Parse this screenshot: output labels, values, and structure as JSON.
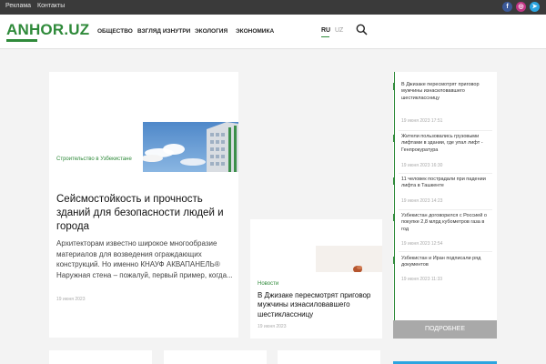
{
  "topbar": {
    "links": [
      "Реклама",
      "Контакты"
    ],
    "social": [
      {
        "name": "facebook-icon",
        "glyph": "f",
        "color": "#3b5998"
      },
      {
        "name": "instagram-icon",
        "glyph": "◎",
        "color": "#c13584"
      },
      {
        "name": "telegram-icon",
        "glyph": "➤",
        "color": "#2ca5e0"
      }
    ]
  },
  "header": {
    "logo": "ANHOR.UZ",
    "nav": [
      "Общество",
      "Взгляд изнутри",
      "Экология",
      "Экономика"
    ],
    "lang_active": "RU",
    "lang_other": "UZ",
    "search_icon": "search-icon"
  },
  "colors": {
    "accent": "#2f8a3a",
    "topbar": "#3a3a3a",
    "button": "#a9a9a9"
  },
  "featured": {
    "category": "Строительство в Узбекистане",
    "title": "Сейсмостойкость и прочность зданий для безопасности людей и города",
    "excerpt": "Архитекторам известно широкое многообразие материалов для возведения ограждающих конструкций. Но именно КНАУФ АКВАПАНЕЛЬ® Наружная стена – пожалуй, первый пример, когда...",
    "date": "19 июня 2023"
  },
  "secondary": {
    "category": "Новости",
    "title": "В Джизаке пересмотрят приговор мужчины изнасиловавшего шестиклассницу",
    "date": "19 июня 2023"
  },
  "feed": {
    "items": [
      {
        "text": "В Джизаке пересмотрят приговор мужчины изнасиловавшего шестиклассницу",
        "date": "19 июня 2023 17:51"
      },
      {
        "text": "Жители пользовались грузовыми лифтами в здании, где упал лифт - Генпрокуратура",
        "date": "19 июня 2023 16:30"
      },
      {
        "text": "11 человек пострадали при падении лифта в Ташкенте",
        "date": "19 июня 2023 14:23"
      },
      {
        "text": "Узбекистан договорился с Россией о покупке 2,8 млрд кубометров газа в год",
        "date": "19 июня 2023 12:54"
      },
      {
        "text": "Узбекистан и Иран подписали ряд документов",
        "date": "19 июня 2023 11:33"
      }
    ],
    "more_label": "Подробнее"
  }
}
